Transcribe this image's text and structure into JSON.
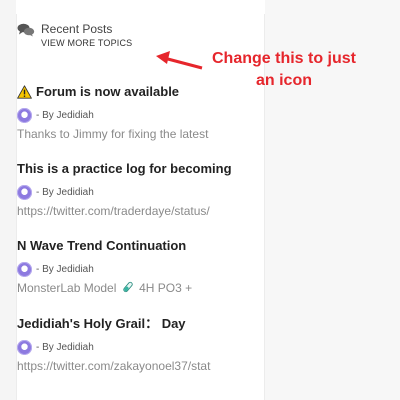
{
  "widget": {
    "title": "Recent Posts",
    "view_more": "VIEW MORE TOPICS",
    "icon": "chat-bubbles-icon"
  },
  "posts": [
    {
      "title": "Forum is now available",
      "has_warning_icon": true,
      "author": "- By Jedidiah",
      "excerpt": "Thanks to Jimmy for fixing the latest"
    },
    {
      "title": "This is a practice log for becoming",
      "author": "- By Jedidiah",
      "excerpt": "https://twitter.com/traderdaye/status/"
    },
    {
      "title": "N Wave Trend Continuation",
      "author": "- By Jedidiah",
      "excerpt_before": "MonsterLab Model",
      "excerpt_after": "4H PO3 +",
      "excerpt_icon": "test-tube-icon"
    },
    {
      "title": "Jedidiah's Holy Grail：  Day",
      "author": "- By Jedidiah",
      "excerpt": "https://twitter.com/zakayonoel37/stat"
    }
  ],
  "annotation": {
    "text": "Change this to just an icon",
    "color": "#e6262c"
  }
}
